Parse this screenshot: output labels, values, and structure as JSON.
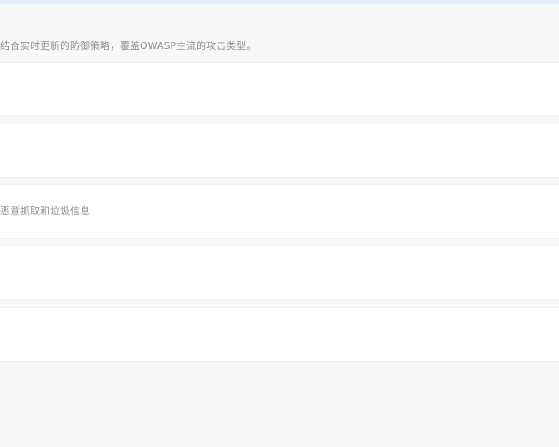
{
  "top_description": "结合实时更新的防御策略，覆盖OWASP主流的攻击类型。",
  "rows": [
    {
      "text": ""
    },
    {
      "text": ""
    },
    {
      "text": "恶意抓取和垃圾信息"
    },
    {
      "text": ""
    },
    {
      "text": ""
    }
  ]
}
